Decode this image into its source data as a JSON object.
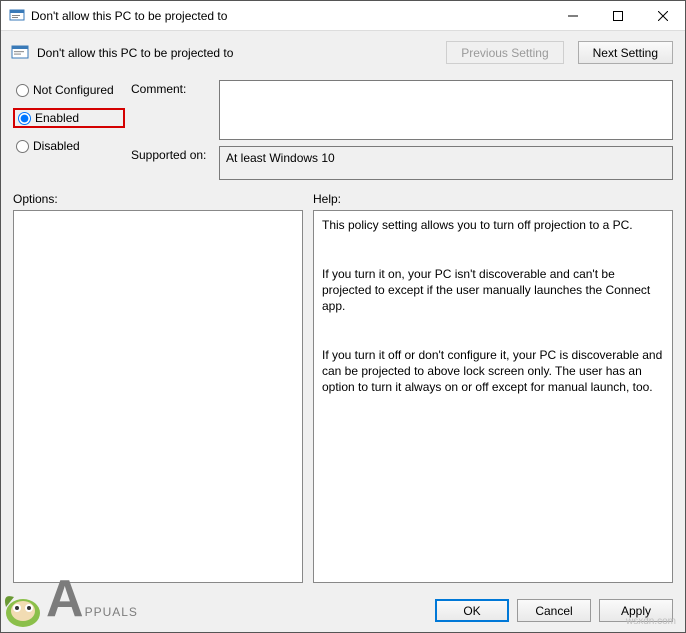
{
  "window": {
    "title": "Don't allow this PC to be projected to"
  },
  "header": {
    "title": "Don't allow this PC to be projected to",
    "prev": "Previous Setting",
    "next": "Next Setting"
  },
  "radios": {
    "not_configured": "Not Configured",
    "enabled": "Enabled",
    "disabled": "Disabled",
    "selected": "enabled"
  },
  "comment": {
    "label": "Comment:",
    "value": ""
  },
  "supported": {
    "label": "Supported on:",
    "value": "At least Windows 10"
  },
  "labels": {
    "options": "Options:",
    "help": "Help:"
  },
  "options": "",
  "help": "This policy setting allows you to turn off projection to a PC.\n\n\nIf you turn it on, your PC isn't discoverable and can't be projected to except if the user manually launches the Connect app.\n\n\nIf you turn it off or don't configure it, your PC is discoverable and can be projected to above lock screen only. The user has an option to turn it always on or off except for manual launch, too.",
  "buttons": {
    "ok": "OK",
    "cancel": "Cancel",
    "apply": "Apply"
  },
  "watermark": {
    "brand_part1": "A",
    "brand_part2": "PPUALS",
    "site": "wsxdn.com"
  }
}
